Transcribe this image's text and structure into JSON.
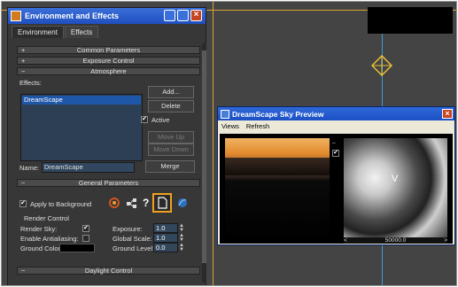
{
  "env_dialog": {
    "title": "Environment and Effects",
    "tabs": [
      "Environment",
      "Effects"
    ],
    "rollouts": {
      "common": "Common Parameters",
      "exposure": "Exposure Control",
      "atmosphere": "Atmosphere",
      "general": "General Parameters",
      "daylight": "Daylight Control"
    },
    "effects_label": "Effects:",
    "effects_list": [
      "DreamScape"
    ],
    "buttons": {
      "add": "Add...",
      "delete": "Delete",
      "move_up": "Move Up",
      "move_down": "Move Down",
      "merge": "Merge"
    },
    "active_label": "Active",
    "name_label": "Name:",
    "name_value": "DreamScape",
    "apply_background": "Apply to Background",
    "render_control": "Render Control",
    "render_sky": "Render Sky:",
    "enable_antialiasing": "Enable Antialiasing:",
    "ground_color": "Ground Color:",
    "exposure_label": "Exposure:",
    "exposure_value": "1.0",
    "global_scale_label": "Global Scale:",
    "global_scale_value": "1.0",
    "ground_level_label": "Ground Level:",
    "ground_level_value": "0.0"
  },
  "preview": {
    "title": "DreamScape Sky Preview",
    "menu": [
      "Views",
      "Refresh"
    ],
    "scale_value": "50000.0"
  }
}
